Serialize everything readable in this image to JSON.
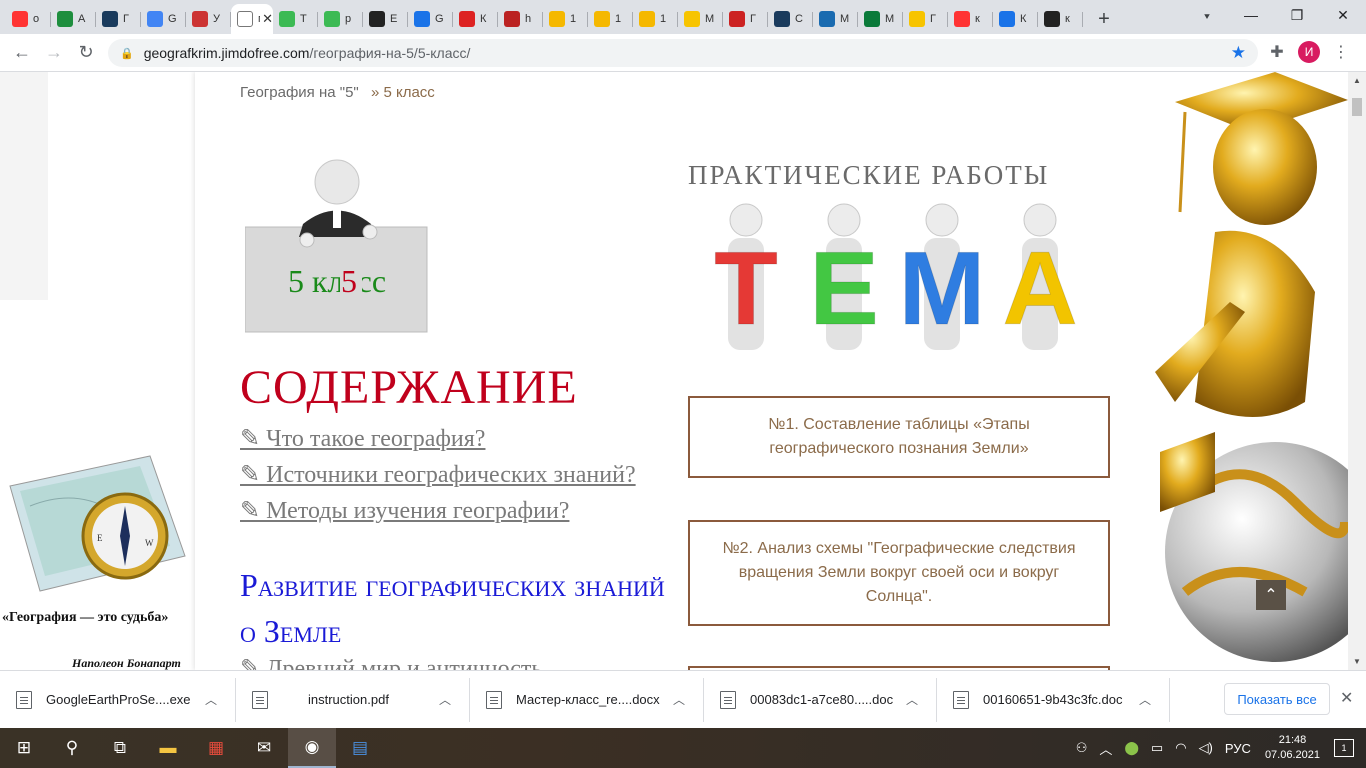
{
  "tabs": [
    {
      "label": "о",
      "icon": "yandex-icon",
      "color": "#f33"
    },
    {
      "label": "А",
      "icon": "doc-icon",
      "color": "#1e8e3e"
    },
    {
      "label": "Г",
      "icon": "q-icon",
      "color": "#1a3b5d"
    },
    {
      "label": "G",
      "icon": "g-icon",
      "color": "#4285f4"
    },
    {
      "label": "У",
      "icon": "bn-icon",
      "color": "#c33"
    },
    {
      "label": "пр",
      "icon": "page-icon",
      "color": "#ffffff",
      "active": true
    },
    {
      "label": "T",
      "icon": "g-icon",
      "color": "#3cba54"
    },
    {
      "label": "р",
      "icon": "g-icon",
      "color": "#3cba54"
    },
    {
      "label": "E",
      "icon": "s-icon",
      "color": "#222"
    },
    {
      "label": "G",
      "icon": "globe-icon",
      "color": "#1a73e8"
    },
    {
      "label": "К",
      "icon": "w-icon",
      "color": "#d22"
    },
    {
      "label": "h",
      "icon": "b-icon",
      "color": "#b22"
    },
    {
      "label": "1",
      "icon": "video-icon",
      "color": "#f5b800"
    },
    {
      "label": "1",
      "icon": "video-icon",
      "color": "#f5b800"
    },
    {
      "label": "1",
      "icon": "video-icon",
      "color": "#f5b800"
    },
    {
      "label": "М",
      "icon": "i-icon",
      "color": "#f7c400"
    },
    {
      "label": "Г",
      "icon": "monitor-icon",
      "color": "#c22"
    },
    {
      "label": "С",
      "icon": "m-icon",
      "color": "#1a3b5d"
    },
    {
      "label": "М",
      "icon": "book-icon",
      "color": "#1a6bb0"
    },
    {
      "label": "М",
      "icon": "check-icon",
      "color": "#0a7a3a"
    },
    {
      "label": "Г",
      "icon": "i-icon",
      "color": "#f7c400"
    },
    {
      "label": "к",
      "icon": "yandex-icon",
      "color": "#f33"
    },
    {
      "label": "К",
      "icon": "remote-icon",
      "color": "#1a73e8"
    },
    {
      "label": "к",
      "icon": "photo-icon",
      "color": "#222"
    }
  ],
  "address": {
    "host": "geografkrim.jimdofree.com",
    "path": "/география-на-5/5-класс/"
  },
  "profile_initial": "И",
  "breadcrumb": {
    "home": "География на \"5\"",
    "current": "» 5 класс"
  },
  "classpic_label": "5 класс",
  "section_title": "СОДЕРЖАНИЕ",
  "toc": [
    "✎ Что такое география?",
    "✎ Источники географических знаний?",
    "✎ Методы изучения географии?"
  ],
  "toc_heading": "Развитие географических знаний о Земле",
  "toc_next": "✎ Древний мир и античность",
  "practical_title": "ПРАКТИЧЕСКИЕ РАБОТЫ",
  "tema_letters": [
    "Т",
    "Е",
    "М",
    "А"
  ],
  "tema_colors": [
    "#e53935",
    "#43c743",
    "#2f7de1",
    "#f2c400"
  ],
  "practical_works": [
    "№1. Составление таблицы «Этапы географического познания Земли»",
    "№2. Анализ схемы \"Географические следствия вращения Земли вокруг своей оси и вокруг Солнца\".",
    ""
  ],
  "left_quote": "«География — это судьба»",
  "left_author": "Наполеон Бонапарт",
  "downloads": [
    {
      "name": "GoogleEarthProSe....exe"
    },
    {
      "name": "instruction.pdf"
    },
    {
      "name": "Мастер-класс_re....docx"
    },
    {
      "name": "00083dc1-a7ce80.....doc"
    },
    {
      "name": "00160651-9b43c3fc.doc"
    }
  ],
  "show_all_label": "Показать все",
  "tray": {
    "lang": "РУС",
    "time": "21:48",
    "date": "07.06.2021",
    "notifications": "1"
  }
}
